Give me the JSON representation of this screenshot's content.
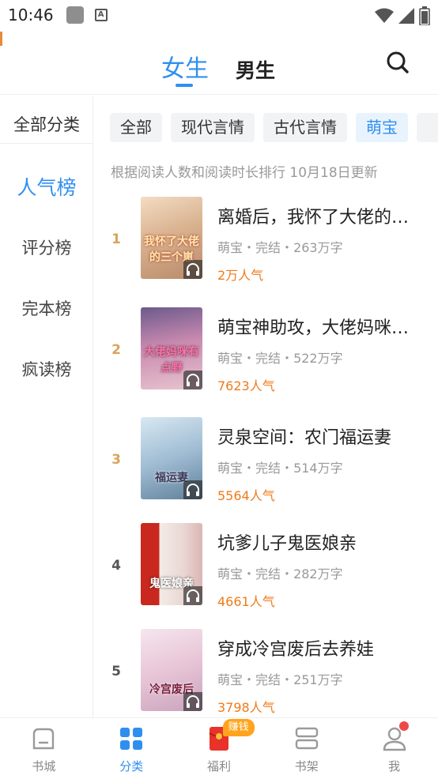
{
  "status": {
    "time": "10:46"
  },
  "header": {
    "tab_female": "女生",
    "tab_male": "男生"
  },
  "sidebar": {
    "all_categories": "全部分类",
    "items": [
      {
        "label": "人气榜",
        "active": true
      },
      {
        "label": "评分榜",
        "active": false
      },
      {
        "label": "完本榜",
        "active": false
      },
      {
        "label": "疯读榜",
        "active": false
      }
    ]
  },
  "chips": [
    {
      "label": "全部",
      "active": false
    },
    {
      "label": "现代言情",
      "active": false
    },
    {
      "label": "古代言情",
      "active": false
    },
    {
      "label": "萌宝",
      "active": true
    }
  ],
  "rank_note": "根据阅读人数和阅读时长排行 10月18日更新",
  "books": [
    {
      "rank": "1",
      "title": "离婚后，我怀了大佬的三个崽",
      "category": "萌宝",
      "status": "完结",
      "words": "263万字",
      "popularity": "2万人气",
      "cover_text": "我怀了大佬的三个崽"
    },
    {
      "rank": "2",
      "title": "萌宝神助攻，大佬妈咪有点野",
      "category": "萌宝",
      "status": "完结",
      "words": "522万字",
      "popularity": "7623人气",
      "cover_text": "大佬妈咪有点野"
    },
    {
      "rank": "3",
      "title": "灵泉空间：农门福运妻",
      "category": "萌宝",
      "status": "完结",
      "words": "514万字",
      "popularity": "5564人气",
      "cover_text": "福运妻"
    },
    {
      "rank": "4",
      "title": "坑爹儿子鬼医娘亲",
      "category": "萌宝",
      "status": "完结",
      "words": "282万字",
      "popularity": "4661人气",
      "cover_text": "鬼医娘亲"
    },
    {
      "rank": "5",
      "title": "穿成冷宫废后去养娃",
      "category": "萌宝",
      "status": "完结",
      "words": "251万字",
      "popularity": "3798人气",
      "cover_text": "冷宫废后"
    }
  ],
  "meta_separator": "・",
  "bottom_nav": {
    "items": [
      {
        "label": "书城"
      },
      {
        "label": "分类"
      },
      {
        "label": "福利"
      },
      {
        "label": "书架"
      },
      {
        "label": "我"
      }
    ],
    "earn_badge": "赚钱"
  },
  "colors": {
    "accent": "#2f8ff0",
    "popularity": "#f07a1a",
    "rank_gold": "#d9a45a",
    "rank_gray": "#555555"
  },
  "icons": {
    "status": [
      "gallery-icon",
      "a-icon",
      "wifi-icon",
      "signal-icon",
      "battery-icon"
    ],
    "header": "search-icon",
    "nav": [
      "home-icon",
      "grid-icon",
      "red-envelope-icon",
      "bookshelf-icon",
      "profile-icon"
    ],
    "cover": "headphones-icon"
  }
}
